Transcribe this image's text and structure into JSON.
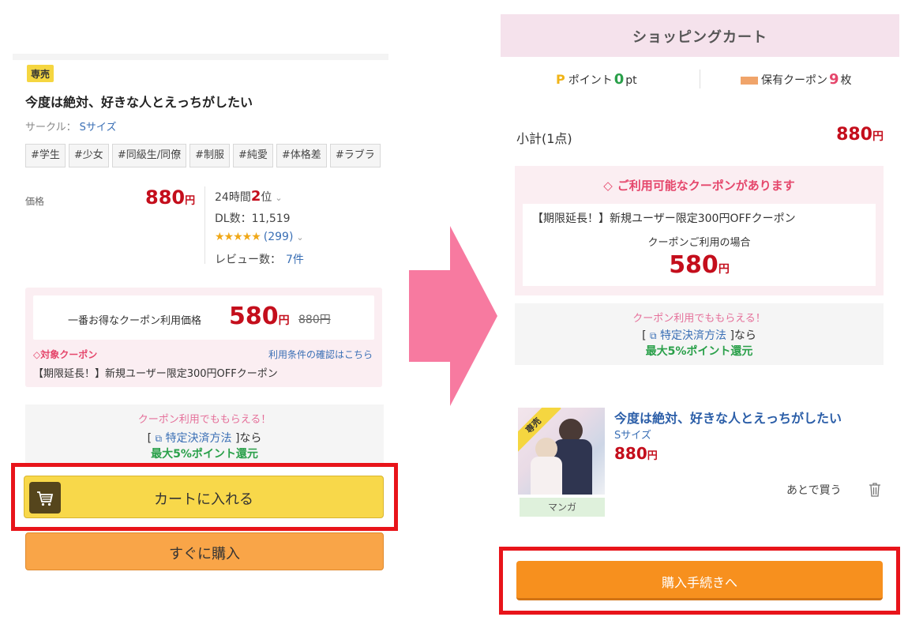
{
  "product": {
    "badge": "専売",
    "title": "今度は絶対、好きな人とえっちがしたい",
    "circle_label": "サークル：",
    "circle_name": "Sサイズ",
    "tags": [
      "#学生",
      "#少女",
      "#同級生/同僚",
      "#制服",
      "#純愛",
      "#体格差",
      "#ラブラ"
    ],
    "price_label": "価格",
    "price": "880",
    "yen": "円",
    "rank_prefix": "24時間",
    "rank_value": "2",
    "rank_suffix": "位",
    "dl_text": "DL数：11,519",
    "stars": "★★★★★",
    "rating_count": "(299)",
    "review_label": "レビュー数：",
    "review_count": "7件"
  },
  "coupon": {
    "best_label": "一番お得なクーポン利用価格",
    "best_price": "580",
    "original_price": "880円",
    "target_label": "対象クーポン",
    "terms_link": "利用条件の確認はこちら",
    "coupon_name": "【期限延長！】新規ユーザー限定300円OFFクーポン"
  },
  "benefit": {
    "line1": "クーポン利用でももらえる！",
    "bracket_open": "[",
    "method_link": "特定決済方法",
    "bracket_close": "]なら",
    "line3": "最大5%ポイント還元"
  },
  "buttons": {
    "add_to_cart": "カートに入れる",
    "buy_now": "すぐに購入",
    "checkout": "購入手続きへ"
  },
  "cart": {
    "header": "ショッピングカート",
    "points_label": "ポイント",
    "points_value": "0",
    "points_unit": "pt",
    "coupons_label": "保有クーポン",
    "coupons_value": "9",
    "coupons_unit": "枚",
    "subtotal_label": "小計(1点)",
    "subtotal_price": "880",
    "available_coupon": "ご利用可能なクーポンがあります",
    "coupon_name": "【期限延長！】新規ユーザー限定300円OFFクーポン",
    "use_case": "クーポンご利用の場合",
    "coupon_price": "580"
  },
  "cart_item": {
    "badge": "専売",
    "title": "今度は絶対、好きな人とえっちがしたい",
    "circle": "Sサイズ",
    "price": "880",
    "category": "マンガ",
    "buy_later": "あとで買う"
  },
  "colors": {
    "price_red": "#c40e1c",
    "accent_pink": "#e5466b",
    "point_green": "#2aa04a",
    "cart_yellow": "#f8d84a",
    "checkout_orange": "#f7901e",
    "highlight_red": "#e8141a",
    "arrow_pink": "#f77aa0"
  },
  "icons": [
    "cart-icon",
    "tag-icon",
    "window-icon",
    "chevron-down-icon",
    "trash-icon",
    "point-icon",
    "coupon-icon",
    "arrow-right-icon"
  ]
}
